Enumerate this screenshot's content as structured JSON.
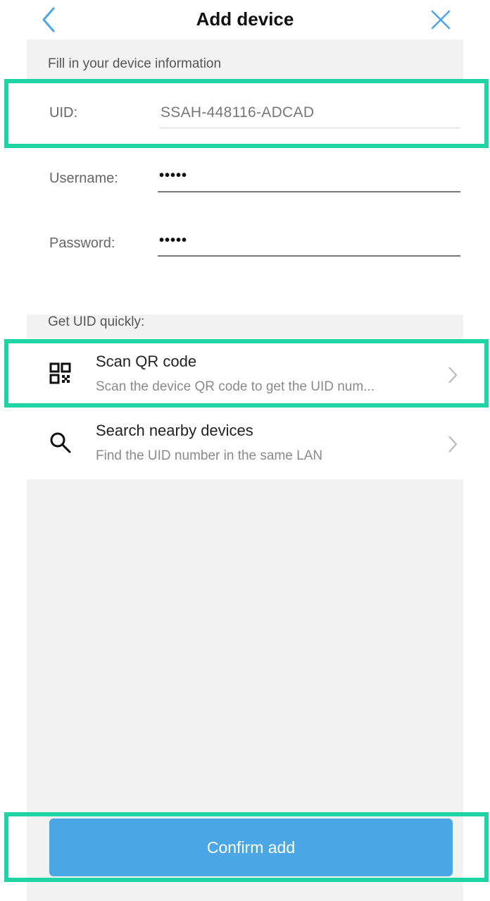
{
  "header": {
    "title": "Add device",
    "back_icon": "chevron-left-icon",
    "close_icon": "close-icon",
    "icon_color": "#4ba6e6"
  },
  "form": {
    "section_label": "Fill in your device information",
    "uid": {
      "label": "UID:",
      "value": "SSAH-448116-ADCAD"
    },
    "username": {
      "label": "Username:",
      "value": "•••••"
    },
    "password": {
      "label": "Password:",
      "value": "•••••"
    }
  },
  "quick": {
    "section_label": "Get UID quickly:",
    "items": [
      {
        "icon": "qr-code-icon",
        "title": "Scan QR code",
        "subtitle": "Scan the device QR code to get the UID num..."
      },
      {
        "icon": "search-icon",
        "title": "Search nearby devices",
        "subtitle": "Find the UID number in the same LAN"
      }
    ]
  },
  "footer": {
    "confirm_label": "Confirm add",
    "button_color": "#4ba6e6"
  },
  "highlight_color": "#1fd4a4"
}
